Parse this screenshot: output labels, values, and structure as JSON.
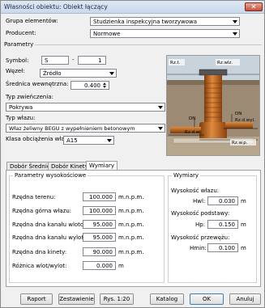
{
  "window": {
    "title": "Własności obiektu: Obiekt łączący"
  },
  "header": {
    "grupa_label": "Grupa elementów:",
    "grupa_value": "Studzienka inspekcyjna tworzywowa",
    "producent_label": "Producent:",
    "producent_value": "Normowe"
  },
  "parametry": {
    "title": "Parametry",
    "symbol_label": "Symbol:",
    "symbol_a": "S",
    "symbol_sep": "-",
    "symbol_b": "1",
    "wezel_label": "Węzeł:",
    "wezel_value": "Źródło",
    "srednica_label": "Średnica wewnętrzna:",
    "srednica_value": "0.400",
    "typ_zw_label": "Typ zwieńczenia:",
    "typ_zw_value": "Pokrywa",
    "typ_wlazu_label": "Typ włazu:",
    "typ_wlazu_value": "Właz żeliwny BEGU z wypełnieniem betonowym",
    "klasa_label": "Klasa obciążenia włazu:",
    "klasa_value": "A15"
  },
  "diagram": {
    "rzt": "Rz.t.",
    "rzwlz": "Rz.wlz.",
    "rzdwlot": "Rz.d.wl.",
    "rzdwylot": "Rz.d.wyl.",
    "rzwp": "Rz.w.p.",
    "dn_left": "DN",
    "dn_right": "DN"
  },
  "tabs": [
    "Dobór Średnicy",
    "Dobór Kinety",
    "Wymiary"
  ],
  "wysokosci": {
    "title": "Parametry wysokościowe",
    "unit": "m.n.p.m.",
    "rows": [
      {
        "label": "Rzędna terenu:",
        "value": "100.000"
      },
      {
        "label": "Rzędna górna włazu:",
        "value": "100.000"
      },
      {
        "label": "Rzędna dna kanału wlotowego:",
        "value": "95.000"
      },
      {
        "label": "Rzędna dna kanału wylotowego:",
        "value": "95.000"
      },
      {
        "label": "Rzędna dna kinety:",
        "value": "90.000"
      }
    ],
    "roznica_label": "Różnica wlot/wylot:",
    "roznica_value": "0.000",
    "roznica_unit": "m"
  },
  "wymiary": {
    "title": "Wymiary",
    "wwlazu_label": "Wysokość włazu:",
    "hwl_label": "Hwl:",
    "hwl_value": "0.030",
    "wpodst_label": "Wysokość podstawy:",
    "hp_label": "Hp:",
    "hp_value": "0.150",
    "wprzew_label": "Wysokość przewężu:",
    "hmin_label": "Hmin:",
    "hmin_value": "0.100",
    "unit": "m"
  },
  "buttons": {
    "raport": "Raport",
    "zestawienie": "Zestawienie",
    "rys": "Rys. 1:20",
    "katalog": "Katalog",
    "ok": "OK",
    "anuluj": "Anuluj"
  },
  "colors": {
    "pipe": "#c46a1f",
    "sky": "#c9d3dc",
    "soil": "#9c8a74"
  }
}
